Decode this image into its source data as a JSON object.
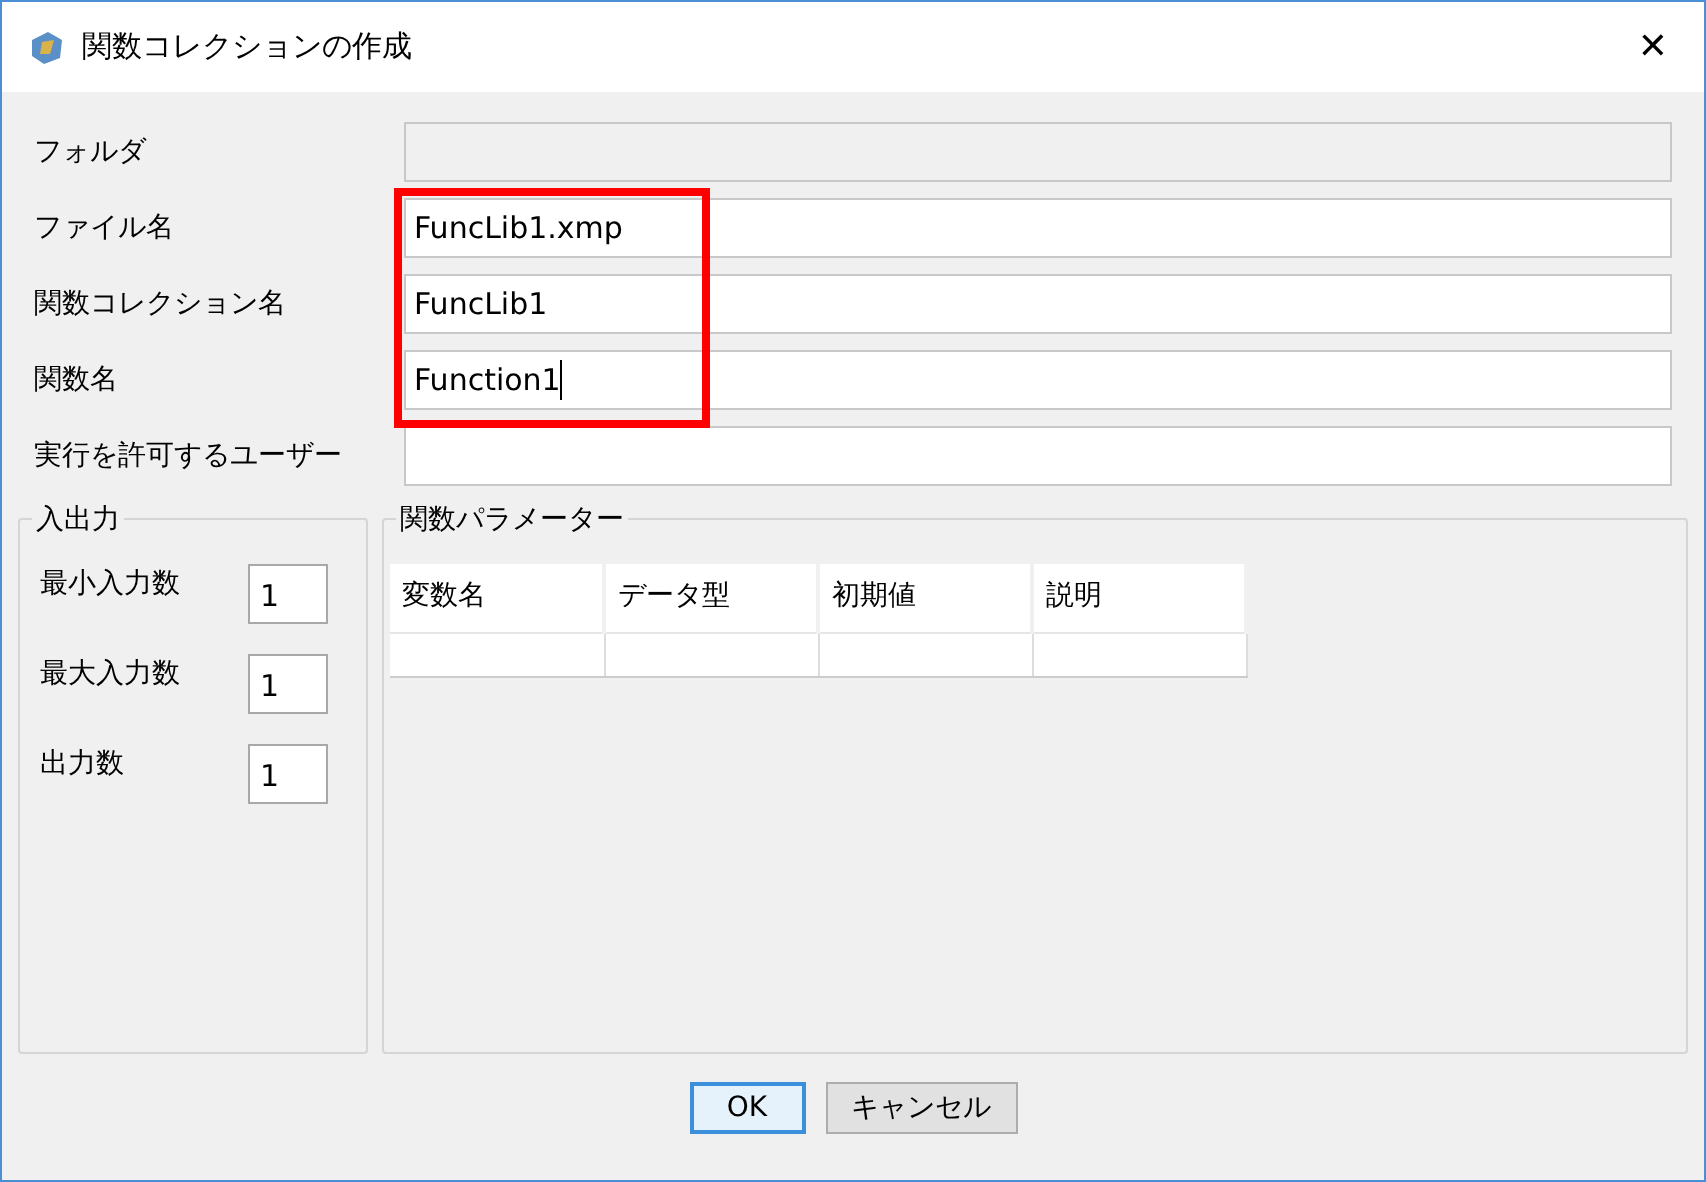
{
  "window": {
    "title": "関数コレクションの作成",
    "close": "✕"
  },
  "fields": [
    {
      "label": "フォルダ",
      "disabled": true,
      "focused": false
    },
    {
      "label": "ファイル名",
      "value": "FuncLib1.xmp",
      "disabled": false,
      "focused": false
    },
    {
      "label": "関数コレクション名",
      "value": "FuncLib1",
      "disabled": false,
      "focused": false
    },
    {
      "label": "関数名",
      "value": "Function1",
      "disabled": false,
      "focused": true
    },
    {
      "label": "実行を許可するユーザー",
      "disabled": false,
      "focused": false
    }
  ],
  "annotation": {
    "kind": "highlight-frame"
  },
  "io_group": {
    "title": "入出力",
    "fields": [
      {
        "label": "最小入力数",
        "value": "1"
      },
      {
        "label": "最大入力数",
        "value": "1"
      },
      {
        "label": "出力数",
        "value": "1"
      }
    ]
  },
  "params_group": {
    "title": "関数パラメーター",
    "columns": [
      "変数名",
      "データ型",
      "初期値",
      "説明"
    ]
  },
  "buttons": [
    {
      "label": "OK",
      "default": true
    },
    {
      "label": "キャンセル",
      "default": false
    }
  ]
}
